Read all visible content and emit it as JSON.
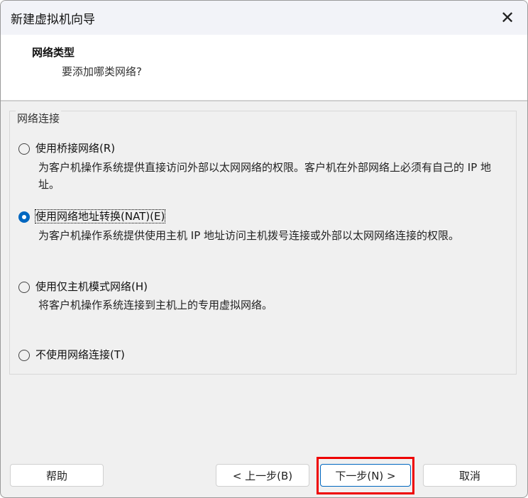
{
  "window": {
    "title": "新建虚拟机向导",
    "close": "✕"
  },
  "header": {
    "title": "网络类型",
    "subtitle": "要添加哪类网络?"
  },
  "group": {
    "label": "网络连接"
  },
  "options": [
    {
      "label": "使用桥接网络(R)",
      "desc": "为客户机操作系统提供直接访问外部以太网网络的权限。客户机在外部网络上必须有自己的 IP 地址。",
      "selected": false
    },
    {
      "label": "使用网络地址转换(NAT)(E)",
      "desc": "为客户机操作系统提供使用主机 IP 地址访问主机拨号连接或外部以太网网络连接的权限。",
      "selected": true
    },
    {
      "label": "使用仅主机模式网络(H)",
      "desc": "将客户机操作系统连接到主机上的专用虚拟网络。",
      "selected": false
    },
    {
      "label": "不使用网络连接(T)",
      "selected": false
    }
  ],
  "buttons": {
    "help": "帮助",
    "back": "< 上一步(B)",
    "next": "下一步(N) >",
    "cancel": "取消"
  }
}
